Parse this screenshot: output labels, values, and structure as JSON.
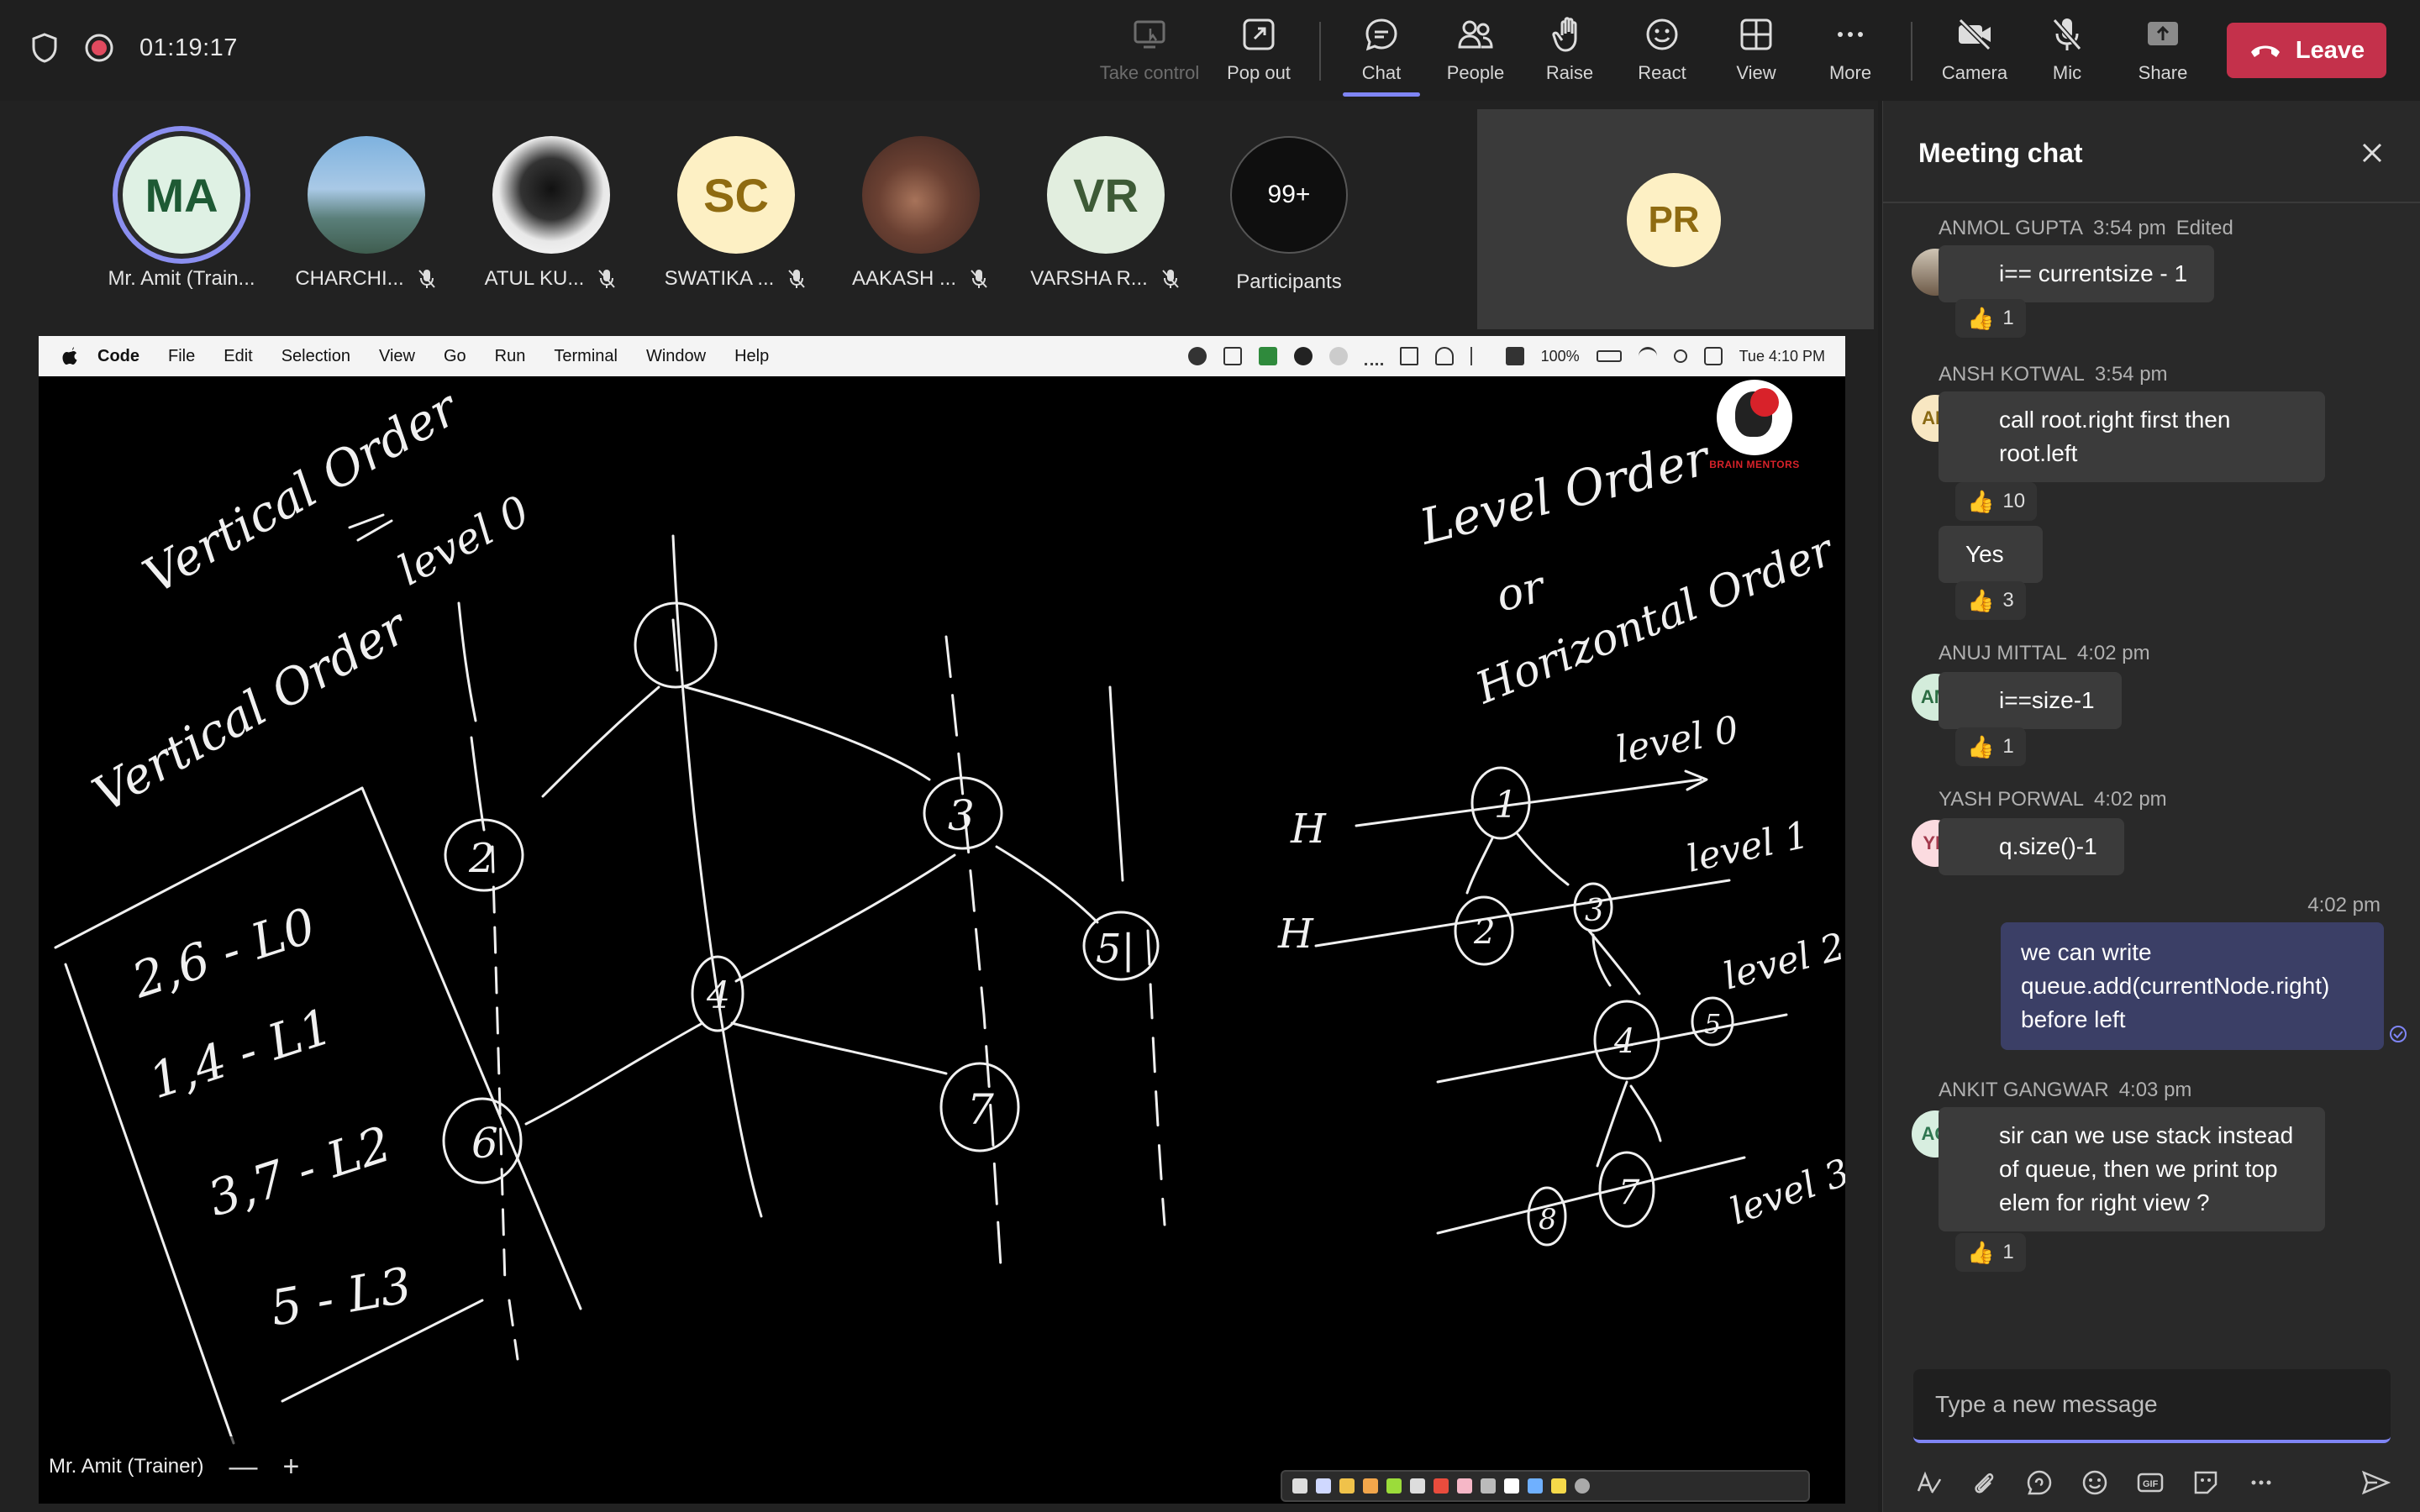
{
  "topbar": {
    "timer": "01:19:17",
    "buttons": {
      "take_control": "Take control",
      "pop_out": "Pop out",
      "chat": "Chat",
      "people": "People",
      "raise": "Raise",
      "react": "React",
      "view": "View",
      "more": "More",
      "camera": "Camera",
      "mic": "Mic",
      "share": "Share"
    },
    "leave": "Leave"
  },
  "participants": [
    {
      "initials": "MA",
      "name": "Mr. Amit (Train..."
    },
    {
      "initials": "",
      "name": "CHARCHI..."
    },
    {
      "initials": "",
      "name": "ATUL KU..."
    },
    {
      "initials": "SC",
      "name": "SWATIKA ..."
    },
    {
      "initials": "",
      "name": "AAKASH ..."
    },
    {
      "initials": "VR",
      "name": "VARSHA R..."
    },
    {
      "initials": "99+",
      "name": "Participants"
    }
  ],
  "side_tile": {
    "initials": "PR"
  },
  "mac_menu": {
    "items": [
      "Code",
      "File",
      "Edit",
      "Selection",
      "View",
      "Go",
      "Run",
      "Terminal",
      "Window",
      "Help"
    ],
    "battery": "100%",
    "clock": "Tue 4:10 PM"
  },
  "whiteboard": {
    "logo_text": "BRAIN MENTORS",
    "left_title_1": "Vertical Order",
    "left_title_2": "Vertical Order",
    "level_label": "level 0",
    "box_lines": [
      "2,6 - L0",
      "1,4 - L1",
      "3,7 - L2",
      "5 - L3"
    ],
    "right_title": [
      "Level Order",
      "or",
      "Horizontal Order"
    ],
    "right_levels": [
      "level 0",
      "level 1",
      "level 2",
      "level 3"
    ]
  },
  "presenter": {
    "name": "Mr. Amit (Trainer)",
    "minus": "—",
    "plus": "+"
  },
  "chat": {
    "title": "Meeting chat",
    "messages": [
      {
        "author": "ANMOL GUPTA",
        "time": "3:54 pm",
        "edited": "Edited",
        "text": "i== currentsize - 1",
        "reaction_count": "1"
      },
      {
        "author": "ANSH KOTWAL",
        "time": "3:54 pm",
        "initials": "AK",
        "text_1": "call root.right first then",
        "text_2": "root.left",
        "reaction_count": "10"
      },
      {
        "text": "Yes",
        "reaction_count": "3"
      },
      {
        "author": "ANUJ MITTAL",
        "time": "4:02 pm",
        "initials": "AM",
        "text": "i==size-1",
        "reaction_count": "1"
      },
      {
        "author": "YASH PORWAL",
        "time": "4:02 pm",
        "initials": "YP",
        "text": "q.size()-1"
      },
      {
        "time": "4:02 pm",
        "text_1": "we can write",
        "text_2": "queue.add(currentNode.right)",
        "text_3": "before  left"
      },
      {
        "author": "ANKIT GANGWAR",
        "time": "4:03 pm",
        "initials": "AG",
        "text_1": "sir can we use stack instead",
        "text_2": "of queue, then we print top",
        "text_3": "elem for right view ?",
        "reaction_count": "1"
      }
    ],
    "compose_placeholder": "Type a new message"
  }
}
